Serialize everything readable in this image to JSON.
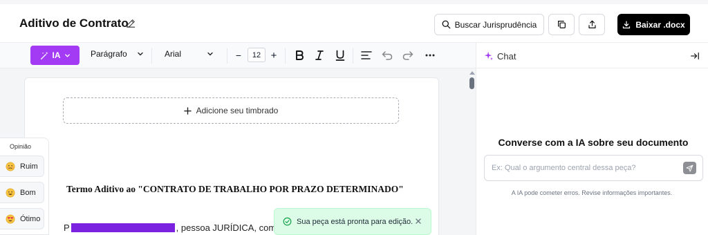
{
  "header": {
    "title": "Aditivo de Contrato",
    "search_label": "Buscar Jurisprudência",
    "download_label": "Baixar .docx"
  },
  "toolbar": {
    "ia_label": "IA",
    "paragraph_style": "Parágrafo",
    "font_family": "Arial",
    "font_size": "12",
    "decrease_label": "−",
    "increase_label": "+"
  },
  "editor": {
    "letterhead_label": "Adicione seu timbrado",
    "heading": "Termo Aditivo ao \"CONTRATO DE TRABALHO POR PRAZO DETERMINADO\"",
    "line_start": "P",
    "line_rest": ", pessoa JURÍDICA, com"
  },
  "feedback": {
    "title": "Opinião",
    "options": [
      {
        "label": "Ruim",
        "icon": "sad-face-icon"
      },
      {
        "label": "Bom",
        "icon": "smile-face-icon"
      },
      {
        "label": "Ótimo",
        "icon": "heart-eyes-icon"
      }
    ]
  },
  "toast": {
    "message": "Sua peça está pronta para edição."
  },
  "chat": {
    "title": "Chat",
    "heading": "Converse com a IA sobre seu documento",
    "placeholder": "Ex: Qual o argumento central dessa peça?",
    "disclaimer": "A IA pode cometer erros. Revise informações importantes."
  },
  "colors": {
    "accent": "#a43bf4",
    "redaction": "#7b22e0",
    "toast_bg": "#dcfce7",
    "primary_button": "#000000"
  }
}
